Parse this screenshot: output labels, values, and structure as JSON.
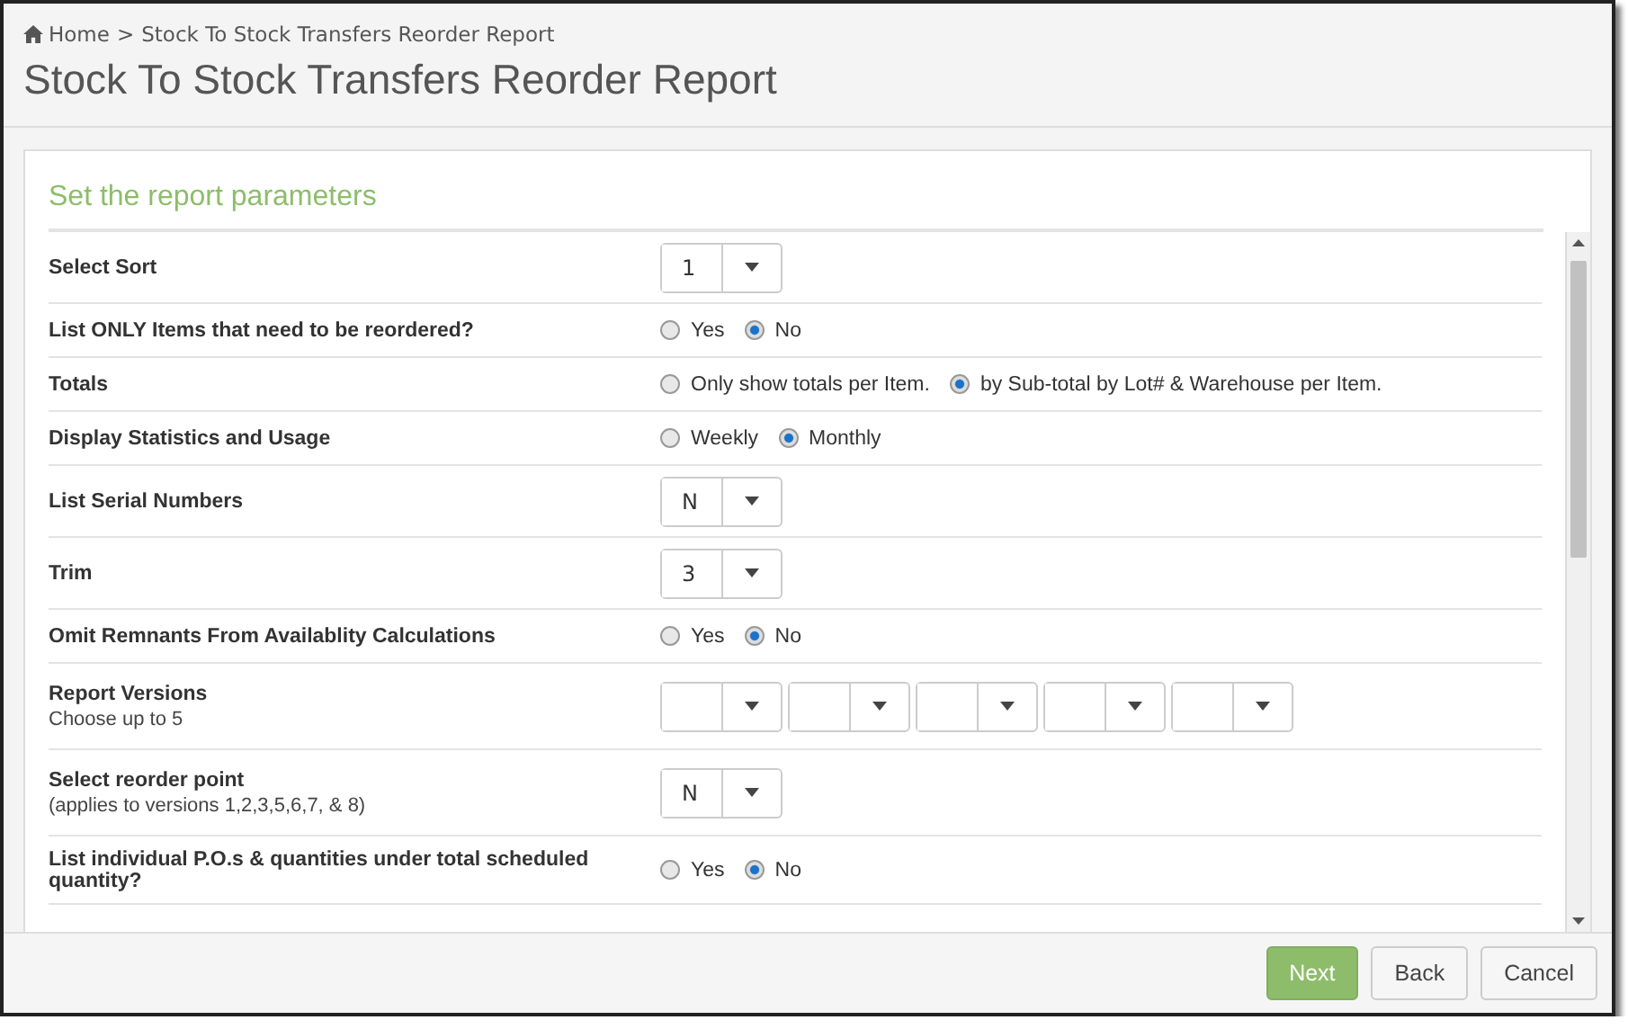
{
  "breadcrumb": {
    "home": "Home",
    "separator": ">",
    "current": "Stock To Stock Transfers Reorder Report"
  },
  "title": "Stock To Stock Transfers Reorder Report",
  "panel": {
    "heading": "Set the report parameters",
    "rows": [
      {
        "kind": "select",
        "label": "Select Sort",
        "values": [
          {
            "empty": false,
            "value": "1"
          }
        ]
      },
      {
        "kind": "radio",
        "label": "List ONLY Items that need to be reordered?",
        "options": [
          {
            "label": "Yes",
            "selected": false
          },
          {
            "label": "No",
            "selected": true
          }
        ]
      },
      {
        "kind": "radio",
        "label": "Totals",
        "options": [
          {
            "label": "Only show totals per Item.",
            "selected": false
          },
          {
            "label": "by Sub-total by Lot# & Warehouse per Item.",
            "selected": true
          }
        ]
      },
      {
        "kind": "radio",
        "label": "Display Statistics and Usage",
        "options": [
          {
            "label": "Weekly",
            "selected": false
          },
          {
            "label": "Monthly",
            "selected": true
          }
        ]
      },
      {
        "kind": "select",
        "label": "List Serial Numbers",
        "values": [
          {
            "empty": false,
            "value": "N"
          }
        ]
      },
      {
        "kind": "select",
        "label": "Trim",
        "values": [
          {
            "empty": false,
            "value": "3"
          }
        ]
      },
      {
        "kind": "radio",
        "label": "Omit Remnants From Availablity Calculations",
        "options": [
          {
            "label": "Yes",
            "selected": false
          },
          {
            "label": "No",
            "selected": true
          }
        ]
      },
      {
        "kind": "select",
        "label": "Report Versions",
        "note": "Choose up to 5",
        "values": [
          {
            "empty": true
          },
          {
            "empty": true
          },
          {
            "empty": true
          },
          {
            "empty": true
          },
          {
            "empty": true
          }
        ]
      },
      {
        "kind": "select",
        "label": "Select reorder point",
        "note": "(applies to versions 1,2,3,5,6,7, & 8)",
        "values": [
          {
            "empty": false,
            "value": "N"
          }
        ]
      },
      {
        "kind": "radio",
        "label": "List individual P.O.s & quantities under total scheduled quantity?",
        "options": [
          {
            "label": "Yes",
            "selected": false
          },
          {
            "label": "No",
            "selected": true
          }
        ]
      }
    ]
  },
  "buttons": [
    {
      "label": "Next",
      "kind": "primary"
    },
    {
      "label": "Back",
      "kind": "default"
    },
    {
      "label": "Cancel",
      "kind": "default"
    }
  ]
}
